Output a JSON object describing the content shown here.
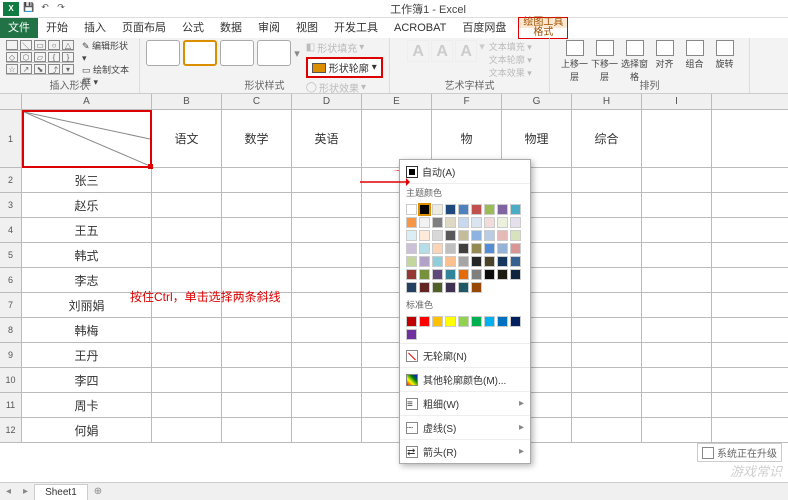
{
  "title": "工作簿1 - Excel",
  "menu": {
    "file": "文件",
    "tabs": [
      "开始",
      "插入",
      "页面布局",
      "公式",
      "数据",
      "审阅",
      "视图",
      "开发工具",
      "ACROBAT",
      "百度网盘"
    ],
    "context_top": "绘图工具",
    "context_bottom": "格式"
  },
  "ribbon": {
    "group_insert_shape": "插入形状",
    "edit_shape": "编辑形状",
    "draw_textbox": "绘制文本框",
    "group_shape_styles": "形状样式",
    "shape_fill": "形状填充",
    "shape_outline": "形状轮廓",
    "shape_effects": "形状效果",
    "group_wordart": "艺术字样式",
    "text_fill": "文本填充",
    "text_outline": "文本轮廓",
    "text_effects": "文本效果",
    "group_arrange": "排列",
    "bring_forward": "上移一层",
    "send_backward": "下移一层",
    "selection_pane": "选择窗格",
    "align": "对齐",
    "group": "组合",
    "rotate": "旋转"
  },
  "popup": {
    "automatic": "自动(A)",
    "theme_colors": "主题颜色",
    "standard_colors": "标准色",
    "no_outline": "无轮廓(N)",
    "more_colors": "其他轮廓颜色(M)...",
    "weight": "粗细(W)",
    "dashes": "虚线(S)",
    "arrows": "箭头(R)",
    "theme_row1": [
      "#ffffff",
      "#000000",
      "#eeece1",
      "#1f497d",
      "#4f81bd",
      "#c0504d",
      "#9bbb59",
      "#8064a2",
      "#4bacc6",
      "#f79646"
    ],
    "theme_shades": [
      [
        "#f2f2f2",
        "#7f7f7f",
        "#ddd9c3",
        "#c6d9f0",
        "#dbe5f1",
        "#f2dcdb",
        "#ebf1dd",
        "#e5e0ec",
        "#dbeef3",
        "#fdeada"
      ],
      [
        "#d8d8d8",
        "#595959",
        "#c4bd97",
        "#8db3e2",
        "#b8cce4",
        "#e5b9b7",
        "#d7e3bc",
        "#ccc1d9",
        "#b7dde8",
        "#fbd5b5"
      ],
      [
        "#bfbfbf",
        "#3f3f3f",
        "#938953",
        "#548dd4",
        "#95b3d7",
        "#d99694",
        "#c3d69b",
        "#b2a2c7",
        "#92cddc",
        "#fac08f"
      ],
      [
        "#a5a5a5",
        "#262626",
        "#494429",
        "#17365d",
        "#366092",
        "#953734",
        "#76923c",
        "#5f497a",
        "#31859b",
        "#e36c09"
      ],
      [
        "#7f7f7f",
        "#0c0c0c",
        "#1d1b10",
        "#0f243e",
        "#244061",
        "#632423",
        "#4f6128",
        "#3f3151",
        "#205867",
        "#974806"
      ]
    ],
    "standard_row": [
      "#c00000",
      "#ff0000",
      "#ffc000",
      "#ffff00",
      "#92d050",
      "#00b050",
      "#00b0f0",
      "#0070c0",
      "#002060",
      "#7030a0"
    ]
  },
  "columns": [
    "A",
    "B",
    "C",
    "D",
    "E",
    "F",
    "G",
    "H",
    "I"
  ],
  "header_row": [
    "",
    "语文",
    "数学",
    "英语",
    "",
    "物",
    "物理",
    "综合",
    ""
  ],
  "names": [
    "张三",
    "赵乐",
    "王五",
    "韩式",
    "李志",
    "刘丽娟",
    "韩梅",
    "王丹",
    "李四",
    "周卡",
    "何娟"
  ],
  "annotation": "按住Ctrl，单击选择两条斜线",
  "sheet_tab": "Sheet1",
  "upgrade_text": "系统正在升级",
  "watermark": "游戏常识"
}
